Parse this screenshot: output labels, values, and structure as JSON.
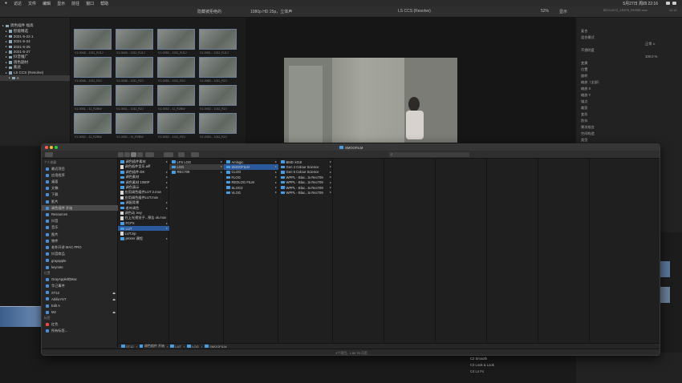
{
  "menubar": {
    "items": [
      "访达",
      "文件",
      "编辑",
      "显示",
      "前往",
      "窗口",
      "帮助"
    ],
    "clock": "5月27日 周四 22:16"
  },
  "fcp": {
    "library_title": "隐藏被拒绝的",
    "viewer_format": "1080p HD 25p，立体声",
    "project_name": "LS CCS (Resolve)",
    "zoom": "52%",
    "view": "显示",
    "inspector_clip": "BCVL0072_1R1F5_RHS9R.mov",
    "inspector_time": "10:14"
  },
  "libraries": [
    {
      "label": "调色插件 福高",
      "level": 0
    },
    {
      "label": "智能精选",
      "level": 1
    },
    {
      "label": "2021-5-22.1",
      "level": 1
    },
    {
      "label": "2021-5-24",
      "level": 1
    },
    {
      "label": "2021-5-25",
      "level": 1
    },
    {
      "label": "2021-5-27",
      "level": 1
    },
    {
      "label": "抖音推广",
      "level": 1
    },
    {
      "label": "调色题材",
      "level": 1
    },
    {
      "label": "素此",
      "level": 1
    },
    {
      "label": "LS CCS (Resolve)",
      "level": 1
    },
    {
      "label": "A",
      "level": 2
    }
  ],
  "thumbs_caption": [
    "V1-0048... 1011_RJ1J",
    "V1-0049... 1011_RJ1J",
    "V1-0050... 1011_RJ1J",
    "V1-0051... 1011_RJ1J",
    "V1-0046... 1011_R2J",
    "V1-0048... 1011_R2J",
    "V1-0050... 1011_R2J",
    "V1-0060... 1011_R2J",
    "V1-0051... 11_R2BW",
    "V1-0051... 1011_R2J",
    "V1-0052... 11_R2BW",
    "V1-0052... 1011_R2J",
    "V1-0052... 11_R2BW",
    "V1-0052... 11_R2BW",
    "V1-0052... 1011_R2J",
    "V1-0053... 1011_R2J"
  ],
  "inspector_rows": [
    "复合",
    "混合模式",
    "正常 ≎",
    "不透明度",
    "100.0 %",
    "变换",
    "位置",
    "旋转",
    "缩放（全部）",
    "缩放 X",
    "缩放 Y",
    "锚点",
    "裁剪",
    "变形",
    "防抖",
    "果冻效应",
    "空间构造",
    "类型",
    "自动 ≎"
  ],
  "finder": {
    "window_title": "SMOOFILM",
    "sidebar": [
      {
        "head": "个人收藏"
      },
      {
        "label": "最近项目"
      },
      {
        "label": "应用程序"
      },
      {
        "label": "桌面"
      },
      {
        "label": "文稿"
      },
      {
        "label": "下载"
      },
      {
        "label": "影片"
      },
      {
        "label": "调色插件 开始",
        "sel": true
      },
      {
        "label": "Resources"
      },
      {
        "label": "抖音"
      },
      {
        "label": "音乐"
      },
      {
        "label": "图片"
      },
      {
        "label": "物件"
      },
      {
        "label": "老朴开讲 MAC PRO"
      },
      {
        "label": "抖音商品"
      },
      {
        "label": "grayapple"
      },
      {
        "label": "keynote"
      },
      {
        "head": "位置"
      },
      {
        "label": "GrayApple的Mac"
      },
      {
        "label": "华己事件"
      },
      {
        "label": "ST12",
        "eject": true
      },
      {
        "label": "AbiliuYST",
        "eject": true
      },
      {
        "label": "Edit A"
      },
      {
        "label": "M2",
        "eject": true
      },
      {
        "head": "标签"
      },
      {
        "label": "红色"
      },
      {
        "label": "所有标签..."
      }
    ],
    "col1": [
      {
        "t": "调色插件素材",
        "k": "folder"
      },
      {
        "t": "调色插件音乐.aiff",
        "k": "doc"
      },
      {
        "t": "调色插件.DK",
        "k": "folder"
      },
      {
        "t": "调色素材",
        "k": "folder"
      },
      {
        "t": "调色素材 1080P",
        "k": "folder"
      },
      {
        "t": "调色演示",
        "k": "folder"
      },
      {
        "t": "应用调色插件LUT 2.mov",
        "k": "doc"
      },
      {
        "t": "应用调色插件LUT.mov",
        "k": "doc"
      },
      {
        "t": "调配背景",
        "k": "folder"
      },
      {
        "t": "老叶调色",
        "k": "folder"
      },
      {
        "t": "调色动 .key",
        "k": "doc"
      },
      {
        "t": "在上光视觉子...预告 ok.mov",
        "k": "doc"
      },
      {
        "t": "FCPX",
        "k": "folder"
      },
      {
        "t": "LUT",
        "k": "folder",
        "sel": true
      },
      {
        "t": "LUT.zip",
        "k": "doc"
      },
      {
        "t": "prores 课程",
        "k": "folder"
      }
    ],
    "col2": [
      {
        "t": "LFS LOG",
        "k": "folder"
      },
      {
        "t": "LOG",
        "k": "folder",
        "hl": true
      },
      {
        "t": "REC709",
        "k": "folder"
      }
    ],
    "col3": [
      {
        "t": "Amlogic",
        "k": "folder"
      },
      {
        "t": "SMOOFILM",
        "k": "folder",
        "sel": true
      },
      {
        "t": "CLOG",
        "k": "folder"
      },
      {
        "t": "FLOG",
        "k": "folder"
      },
      {
        "t": "REDLOG FILM",
        "k": "folder"
      },
      {
        "t": "SLOG3",
        "k": "folder"
      },
      {
        "t": "VLOG",
        "k": "folder"
      }
    ],
    "col4": [
      {
        "t": "BMD XOJI",
        "k": "folder"
      },
      {
        "t": "Gen 4 Colour Science",
        "k": "folder"
      },
      {
        "t": "Gen 5 Colour Science",
        "k": "folder"
      },
      {
        "t": "WPPL - Blac...to Rec709",
        "k": "folder"
      },
      {
        "t": "WPPL - Blac...to Rec709",
        "k": "folder"
      },
      {
        "t": "WPPL - Blac...to Rec709",
        "k": "folder"
      },
      {
        "t": "WPPL - Blac...to Rec709",
        "k": "folder"
      }
    ],
    "path": [
      "ST12",
      "调色插件 开始",
      "LUT",
      "LOG",
      "SMOOFILM"
    ],
    "status": "4个项目，1.86 TB 可用"
  },
  "bottom": {
    "right1": "C2 Smooth",
    "right2": "C3 Look & Look",
    "right3": "C4 Lo Fx"
  }
}
